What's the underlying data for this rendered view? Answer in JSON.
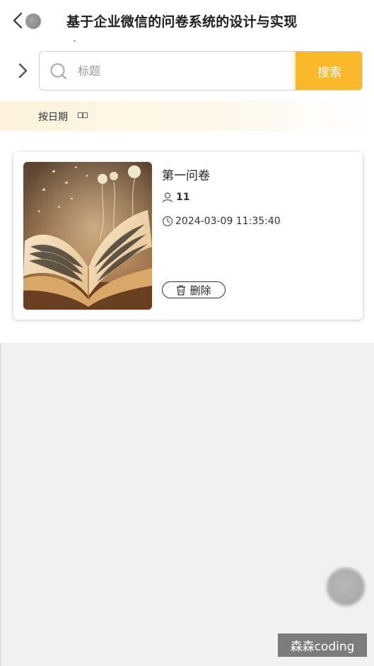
{
  "header": {
    "title": "基于企业微信的问卷系统的设计与实现",
    "back_icon": "chevron-left-icon"
  },
  "search": {
    "placeholder": "标题",
    "value": "",
    "button_label": "搜索",
    "accent_color": "#fbb829"
  },
  "sort": {
    "label": "按日期"
  },
  "survey_list": [
    {
      "title": "第一问卷",
      "participants": "11",
      "datetime": "2024-03-09 11:35:40",
      "delete_label": "删除"
    }
  ],
  "watermark": "森森coding"
}
